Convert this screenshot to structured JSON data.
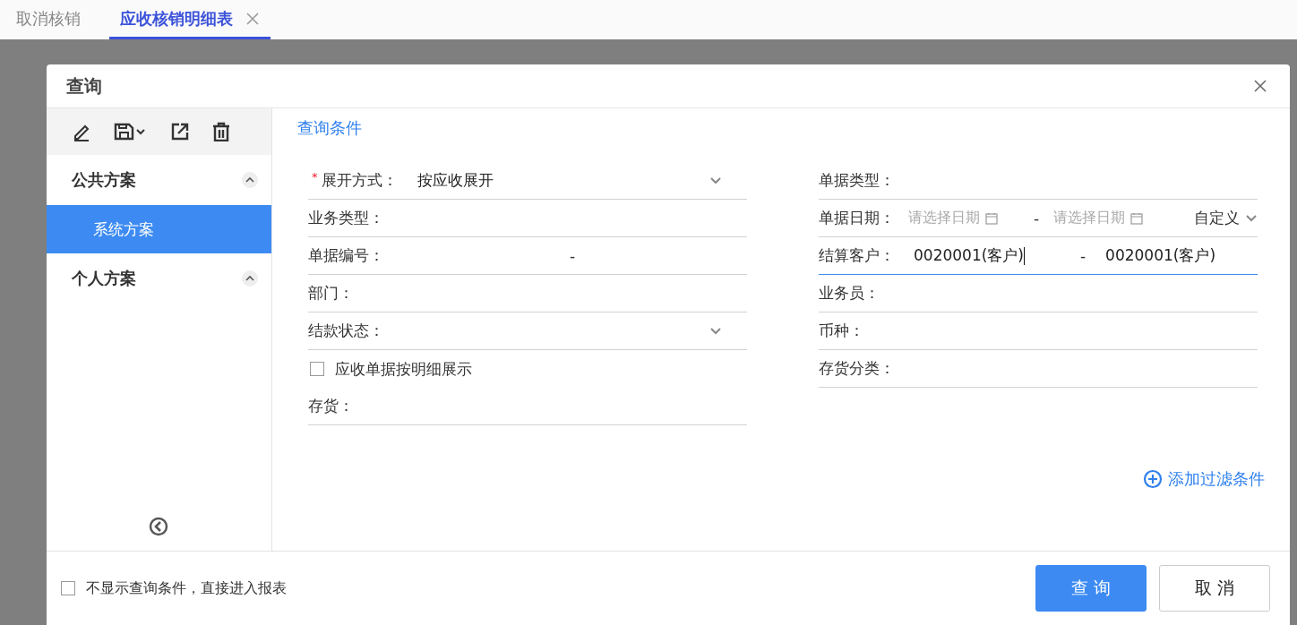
{
  "tabs": [
    {
      "label": "取消核销",
      "selected": false,
      "closable": false
    },
    {
      "label": "应收核销明细表",
      "selected": true,
      "closable": true
    }
  ],
  "dialog": {
    "title": "查询",
    "schemes": [
      {
        "label": "公共方案",
        "expanded": true,
        "children": [
          {
            "label": "系统方案",
            "selected": true
          }
        ]
      },
      {
        "label": "个人方案",
        "expanded": true
      }
    ],
    "section_title": "查询条件",
    "left_fields": [
      {
        "kind": "select",
        "label": "展开方式：",
        "required_mark": "*",
        "value": "按应收展开"
      },
      {
        "kind": "text",
        "label": "业务类型："
      },
      {
        "kind": "range",
        "label": "单据编号：",
        "separator": "-"
      },
      {
        "kind": "text",
        "label": "部门："
      },
      {
        "kind": "select",
        "label": "结款状态："
      },
      {
        "kind": "checkbox",
        "label": "应收单据按明细展示",
        "checked": false
      },
      {
        "kind": "text",
        "label": "存货："
      }
    ],
    "right_fields": [
      {
        "kind": "text",
        "label": "单据类型："
      },
      {
        "kind": "daterange",
        "label": "单据日期：",
        "placeholder_from": "请选择日期",
        "separator": "-",
        "placeholder_to": "请选择日期",
        "mode": "自定义"
      },
      {
        "kind": "range",
        "label": "结算客户：",
        "value_from": "0020001(客户)",
        "separator": "-",
        "value_to": "0020001(客户)",
        "focused": true
      },
      {
        "kind": "text",
        "label": "业务员："
      },
      {
        "kind": "text",
        "label": "币种："
      },
      {
        "kind": "text",
        "label": "存货分类："
      }
    ],
    "add_filter": "添加过滤条件",
    "skip_option": {
      "label": "不显示查询条件，直接进入报表",
      "checked": false
    },
    "buttons": [
      {
        "label": "查 询",
        "kind": "primary"
      },
      {
        "label": "取 消",
        "kind": "default"
      }
    ]
  }
}
